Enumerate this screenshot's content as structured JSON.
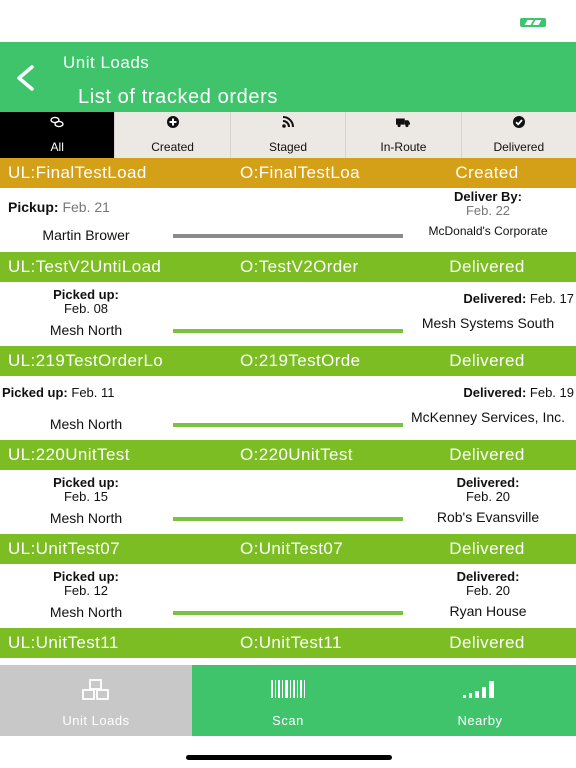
{
  "header": {
    "app_title": "Unit Loads",
    "page_title": "List of tracked orders"
  },
  "tabs": [
    {
      "label": "All",
      "icon": "truck-group-icon",
      "active": true
    },
    {
      "label": "Created",
      "icon": "plus-circle-icon",
      "active": false
    },
    {
      "label": "Staged",
      "icon": "rss-icon",
      "active": false
    },
    {
      "label": "In-Route",
      "icon": "truck-icon",
      "active": false
    },
    {
      "label": "Delivered",
      "icon": "check-circle-icon",
      "active": false
    }
  ],
  "colors": {
    "header_green": "#3fc46c",
    "created": "#d4a017",
    "delivered": "#7cbd24",
    "track_gray": "#8a8a8a",
    "track_green": "#7cc242"
  },
  "orders": [
    {
      "ul": "UL:FinalTestLoad",
      "o": "O:FinalTestLoa",
      "status": "Created",
      "pickup_label": "Pickup:",
      "pickup_date": "Feb. 21",
      "deliver_label": "Deliver By:",
      "deliver_date": "Feb. 22",
      "origin": "Martin Brower",
      "destination": "McDonald's Corporate"
    },
    {
      "ul": "UL:TestV2UntiLoad",
      "o": "O:TestV2Order",
      "status": "Delivered",
      "pickup_label": "Picked up:",
      "pickup_date": "Feb. 08",
      "deliver_label": "Delivered:",
      "deliver_date": "Feb. 17",
      "origin": "Mesh North",
      "destination": "Mesh Systems South"
    },
    {
      "ul": "UL:219TestOrderLo",
      "o": "O:219TestOrde",
      "status": "Delivered",
      "pickup_label": "Picked up:",
      "pickup_date": "Feb. 11",
      "deliver_label": "Delivered:",
      "deliver_date": "Feb. 19",
      "origin": "Mesh North",
      "destination": "McKenney Services, Inc."
    },
    {
      "ul": "UL:220UnitTest",
      "o": "O:220UnitTest",
      "status": "Delivered",
      "pickup_label": "Picked up:",
      "pickup_date": "Feb. 15",
      "deliver_label": "Delivered:",
      "deliver_date": "Feb. 20",
      "origin": "Mesh North",
      "destination": "Rob's Evansville"
    },
    {
      "ul": "UL:UnitTest07",
      "o": "O:UnitTest07",
      "status": "Delivered",
      "pickup_label": "Picked up:",
      "pickup_date": "Feb. 12",
      "deliver_label": "Delivered:",
      "deliver_date": "Feb. 20",
      "origin": "Mesh North",
      "destination": "Ryan House"
    },
    {
      "ul": "UL:UnitTest11",
      "o": "O:UnitTest11",
      "status": "Delivered"
    }
  ],
  "bottom_nav": [
    {
      "label": "Unit Loads",
      "icon": "boxes-icon",
      "active": true
    },
    {
      "label": "Scan",
      "icon": "barcode-icon",
      "active": false
    },
    {
      "label": "Nearby",
      "icon": "signal-bars-icon",
      "active": false
    }
  ]
}
